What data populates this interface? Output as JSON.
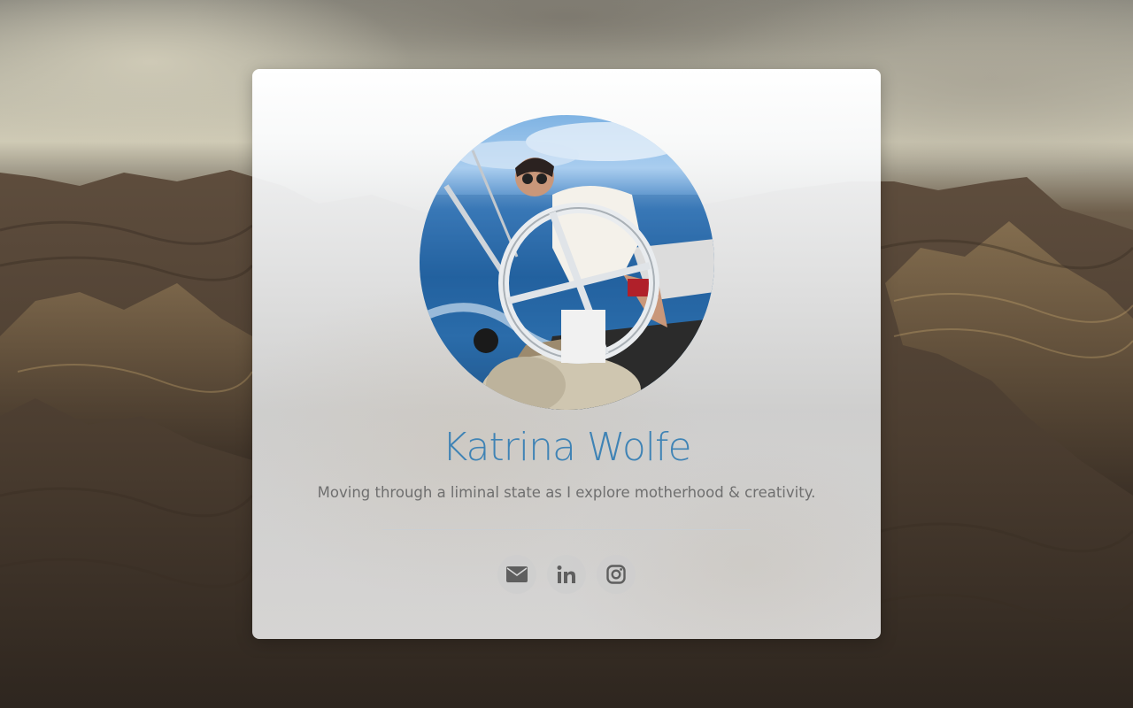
{
  "profile": {
    "name": "Katrina Wolfe",
    "tagline": "Moving through a liminal state as I explore motherhood & creativity.",
    "avatar_icon": "profile-photo"
  },
  "social": [
    {
      "name": "email",
      "icon": "envelope-icon"
    },
    {
      "name": "linkedin",
      "icon": "linkedin-icon"
    },
    {
      "name": "instagram",
      "icon": "instagram-icon"
    }
  ],
  "colors": {
    "name": "#3f83b5",
    "tagline": "#6f6f6f",
    "icon": "#5f5f5f",
    "icon_bg": "#cdcdcd"
  }
}
